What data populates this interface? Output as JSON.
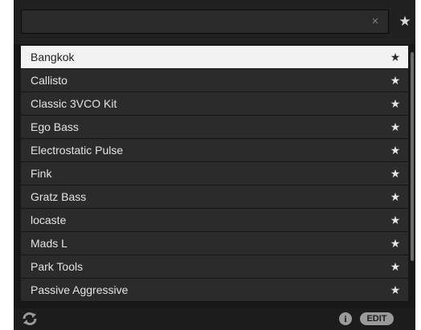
{
  "search": {
    "value": "",
    "placeholder": "",
    "clear_glyph": "×",
    "favorites_glyph": "★"
  },
  "list": {
    "selected_index": 0,
    "star_glyph": "★",
    "items": [
      {
        "label": "Bangkok"
      },
      {
        "label": "Callisto"
      },
      {
        "label": "Classic 3VCO Kit"
      },
      {
        "label": "Ego Bass"
      },
      {
        "label": "Electrostatic Pulse"
      },
      {
        "label": "Fink"
      },
      {
        "label": "Gratz Bass"
      },
      {
        "label": "locaste"
      },
      {
        "label": "Mads L"
      },
      {
        "label": "Park Tools"
      },
      {
        "label": "Passive Aggressive"
      }
    ]
  },
  "footer": {
    "info_glyph": "i",
    "edit_label": "EDIT"
  },
  "icons": {
    "clear": "close-icon",
    "favorites_filter": "star-icon",
    "refresh": "refresh-icon",
    "info": "info-icon"
  },
  "colors": {
    "background": "#181818",
    "row": "#2b2b2b",
    "row_selected": "#f2f2f2",
    "text": "#e4e4e4",
    "text_selected": "#202020",
    "accent_grey": "#9a9a9a"
  }
}
